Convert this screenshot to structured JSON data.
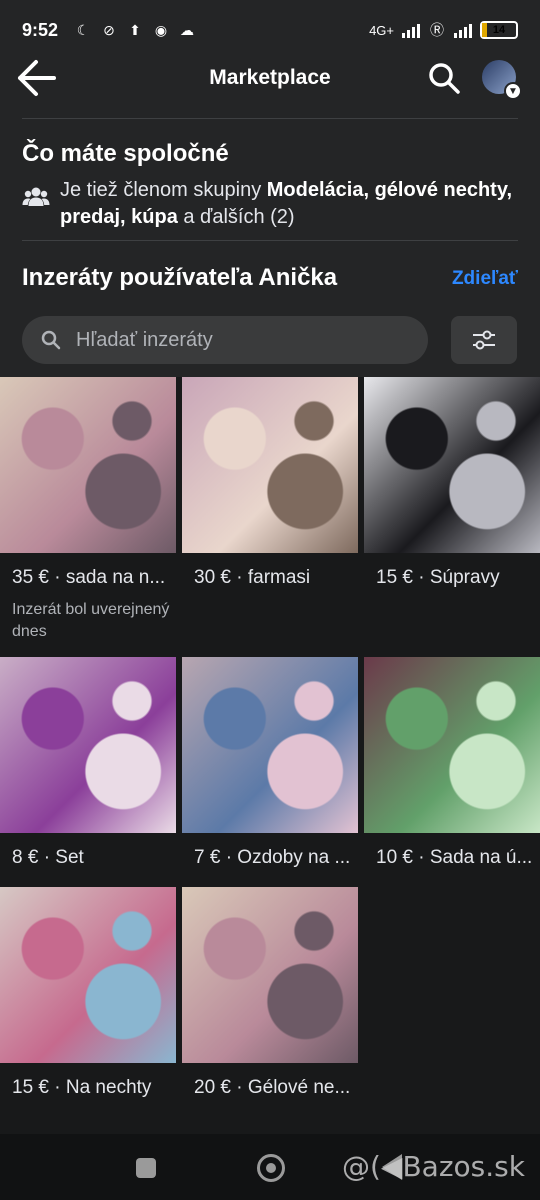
{
  "status_bar": {
    "time": "9:52",
    "network": "4G+",
    "battery": "14",
    "battery_level": 0.14
  },
  "header": {
    "title": "Marketplace"
  },
  "common": {
    "title": "Čo máte spoločné",
    "prefix": "Je tiež členom skupiny ",
    "groups": "Modelácia, gélové nechty, predaj, kúpa",
    "suffix": " a ďalších (2)"
  },
  "listings_section": {
    "title": "Inzeráty používateľa Anička",
    "share": "Zdieľať"
  },
  "search": {
    "placeholder": "Hľadať inzeráty",
    "value": ""
  },
  "listings": [
    {
      "price_title": "35 € · sada na n...",
      "meta": "Inzerát bol uverejnený dnes",
      "colors": [
        "#d9c8b8",
        "#b98a9a",
        "#6d5a66"
      ]
    },
    {
      "price_title": "30 € · farmasi",
      "meta": "",
      "colors": [
        "#c9a6b8",
        "#e9d6cc",
        "#7e6a5e"
      ]
    },
    {
      "price_title": "15 € · Súpravy",
      "meta": "",
      "colors": [
        "#e8e8ec",
        "#1a1a1e",
        "#b8b8c0"
      ]
    },
    {
      "price_title": "8 € · Set",
      "meta": "",
      "colors": [
        "#c9aec6",
        "#8b3f9a",
        "#eadbe6"
      ]
    },
    {
      "price_title": "7 € · Ozdoby na ...",
      "meta": "",
      "colors": [
        "#b8a6b0",
        "#5c7aa8",
        "#e2c2d2"
      ]
    },
    {
      "price_title": "10 € · Sada na ú...",
      "meta": "",
      "colors": [
        "#6b3a4a",
        "#62a06a",
        "#c8e6c6"
      ]
    },
    {
      "price_title": "15 € · Na nechty",
      "meta": "",
      "colors": [
        "#d6c8c4",
        "#c66a8e",
        "#8ab6d0"
      ]
    },
    {
      "price_title": "20 € · Gélové ne...",
      "meta": "",
      "colors": [
        "#d9c8b8",
        "#b98a9a",
        "#6d5a66"
      ]
    }
  ],
  "watermark": "@(◀Bazos.sk"
}
